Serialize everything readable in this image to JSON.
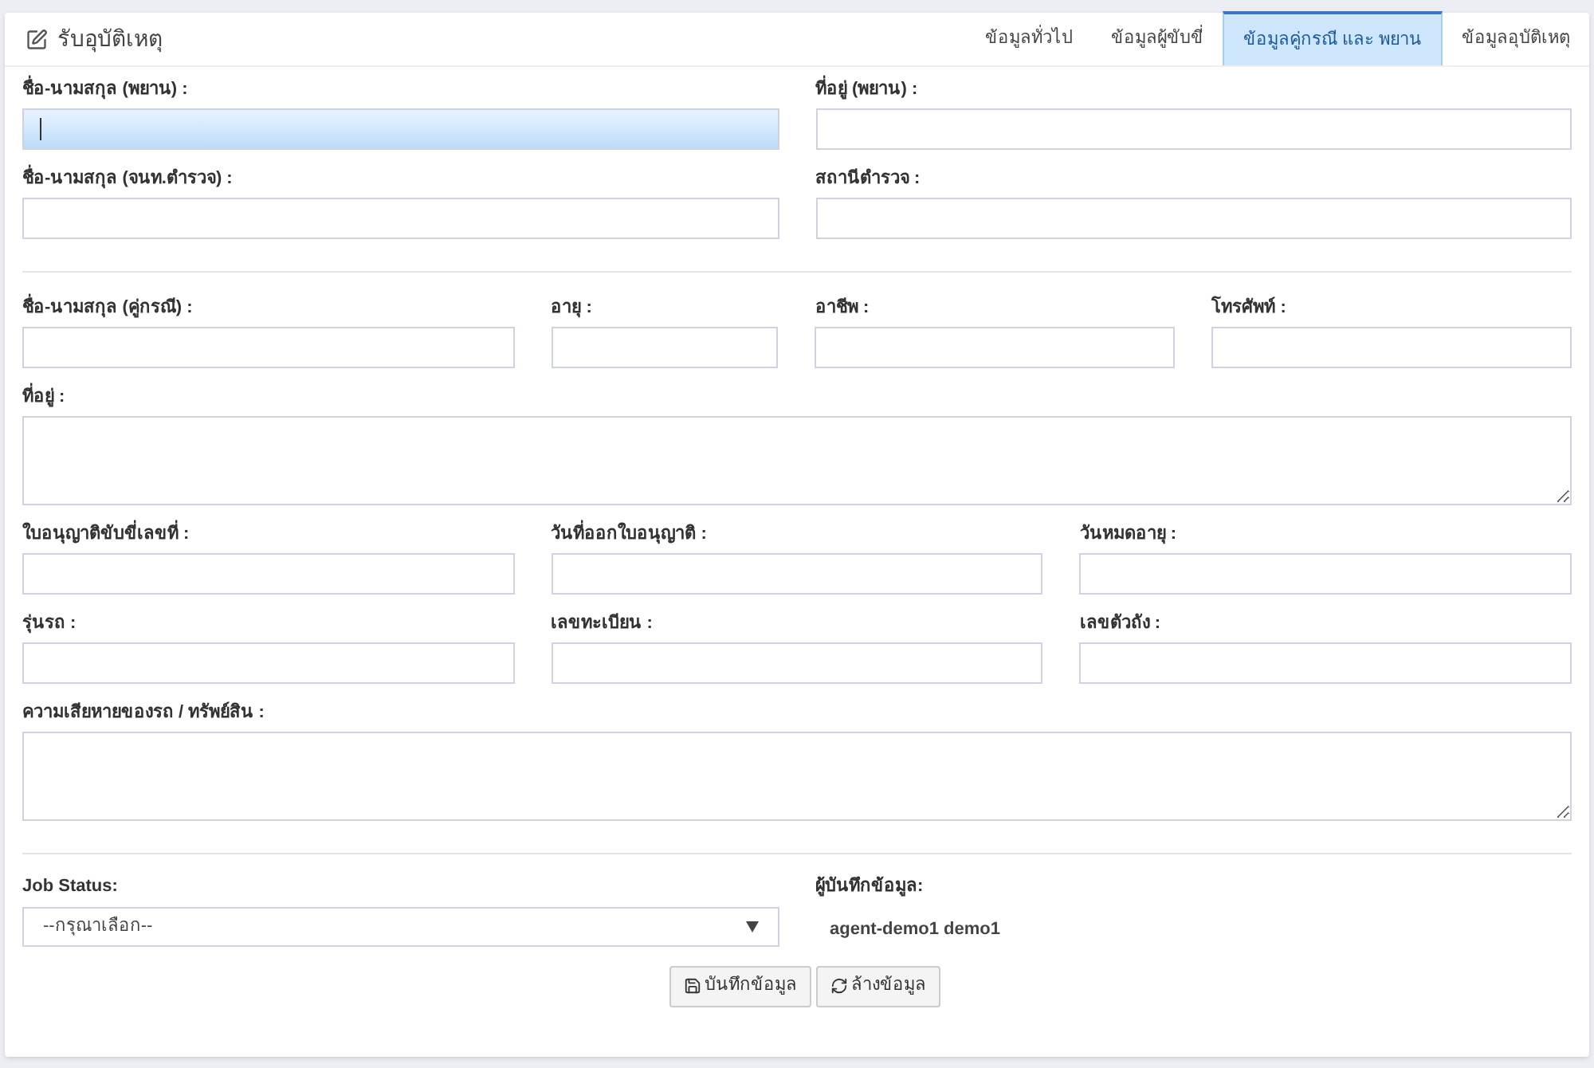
{
  "header": {
    "title": "รับอุบัติเหตุ"
  },
  "tabs": [
    {
      "label": "ข้อมูลทั่วไป",
      "selected": false
    },
    {
      "label": "ข้อมูลผู้ขับขี่",
      "selected": false
    },
    {
      "label": "ข้อมูลคู่กรณี และ พยาน",
      "selected": true
    },
    {
      "label": "ข้อมูลอุบัติเหตุ",
      "selected": false
    }
  ],
  "sections": [
    [
      [
        {
          "label": "ชื่อ-นามสกุล (พยาน) :",
          "kind": "input",
          "focused": true
        },
        {
          "label": "ที่อยู่ (พยาน) :",
          "kind": "input",
          "focused": false
        }
      ],
      [
        {
          "label": "ชื่อ-นามสกุล (จนท.ตำรวจ) :",
          "kind": "input",
          "focused": false
        },
        {
          "label": "สถานีตำรวจ :",
          "kind": "input",
          "focused": false
        }
      ]
    ],
    [
      [
        {
          "label": "ชื่อ-นามสกุล (คู่กรณี) :",
          "kind": "input",
          "focused": false
        },
        {
          "label": "อายุ :",
          "kind": "input",
          "focused": false
        },
        {
          "label": "อาชีพ :",
          "kind": "input",
          "focused": false
        },
        {
          "label": "โทรศัพท์ :",
          "kind": "input",
          "focused": false
        }
      ],
      [
        {
          "label": "ที่อยู่ :",
          "kind": "textarea",
          "focused": false
        }
      ],
      [
        {
          "label": "ใบอนุญาติขับขี่เลขที่ :",
          "kind": "input",
          "focused": false
        },
        {
          "label": "วันที่ออกใบอนุญาติ :",
          "kind": "input",
          "focused": false
        },
        {
          "label": "วันหมดอายุ :",
          "kind": "input",
          "focused": false
        }
      ],
      [
        {
          "label": "รุ่นรถ :",
          "kind": "input",
          "focused": false
        },
        {
          "label": "เลขทะเบียน :",
          "kind": "input",
          "focused": false
        },
        {
          "label": "เลขตัวถัง :",
          "kind": "input",
          "focused": false
        }
      ],
      [
        {
          "label": "ความเสียหายของรถ / ทรัพย์สิน :",
          "kind": "textarea",
          "focused": false
        }
      ]
    ]
  ],
  "job_status": {
    "label": "Job Status:",
    "value": "--กรุณาเลือก--"
  },
  "recorder": {
    "label": "ผู้บันทึกข้อมูล:",
    "value": "agent-demo1 demo1"
  },
  "buttons": [
    {
      "label": "บันทึกข้อมูล",
      "kind": "save"
    },
    {
      "label": "ล้างข้อมูล",
      "kind": "reset"
    }
  ]
}
